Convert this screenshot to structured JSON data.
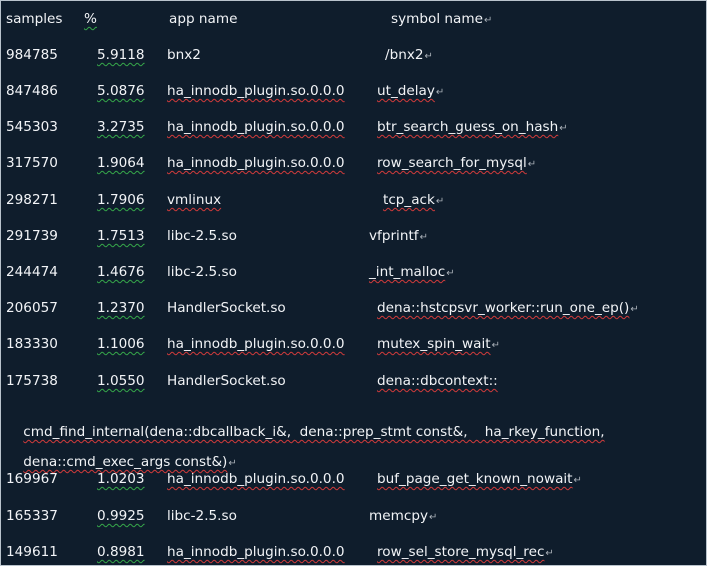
{
  "header": {
    "samples": "samples",
    "percent": "%",
    "app": "app name",
    "symbol": "symbol name"
  },
  "rows": [
    {
      "samples": "984785",
      "percent": "5.9118",
      "app": "bnx2",
      "symbol": "/bnx2"
    },
    {
      "samples": "847486",
      "percent": "5.0876",
      "app": "ha_innodb_plugin.so.0.0.0",
      "symbol": "ut_delay"
    },
    {
      "samples": "545303",
      "percent": "3.2735",
      "app": "ha_innodb_plugin.so.0.0.0",
      "symbol": "btr_search_guess_on_hash"
    },
    {
      "samples": "317570",
      "percent": "1.9064",
      "app": "ha_innodb_plugin.so.0.0.0",
      "symbol": "row_search_for_mysql"
    },
    {
      "samples": "298271",
      "percent": "1.7906",
      "app": "vmlinux",
      "symbol": "tcp_ack"
    },
    {
      "samples": "291739",
      "percent": "1.7513",
      "app": "libc-2.5.so",
      "symbol": "vfprintf"
    },
    {
      "samples": "244474",
      "percent": "1.4676",
      "app": "libc-2.5.so",
      "symbol": "_int_malloc"
    },
    {
      "samples": "206057",
      "percent": "1.2370",
      "app": "HandlerSocket.so",
      "symbol": "dena::hstcpsvr_worker::run_one_ep()"
    },
    {
      "samples": "183330",
      "percent": "1.1006",
      "app": "ha_innodb_plugin.so.0.0.0",
      "symbol": "mutex_spin_wait"
    },
    {
      "samples": "175738",
      "percent": "1.0550",
      "app": "HandlerSocket.so",
      "symbol": "dena::dbcontext::"
    },
    {
      "samples": "169967",
      "percent": "1.0203",
      "app": "ha_innodb_plugin.so.0.0.0",
      "symbol": "buf_page_get_known_nowait"
    },
    {
      "samples": "165337",
      "percent": "0.9925",
      "app": "libc-2.5.so",
      "symbol": "memcpy"
    },
    {
      "samples": "149611",
      "percent": "0.8981",
      "app": "ha_innodb_plugin.so.0.0.0",
      "symbol": "row_sel_store_mysql_rec"
    }
  ],
  "wrap": {
    "line1": "cmd_find_internal(dena::dbcallback_i&,  dena::prep_stmt const&,    ha_rkey_function,",
    "line2": "dena::cmd_exec_args const&)"
  },
  "paragraph_mark": "↵"
}
